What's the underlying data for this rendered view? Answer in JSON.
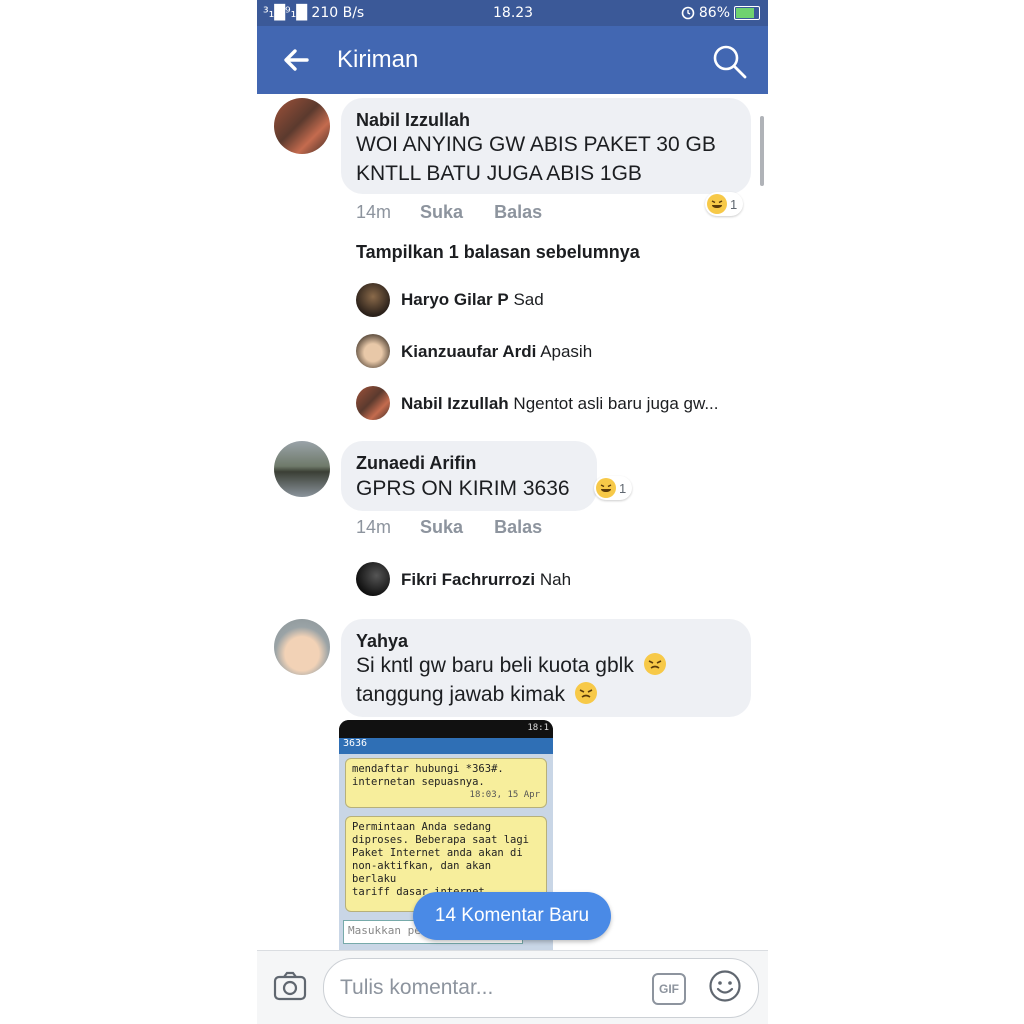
{
  "status_bar": {
    "signal": "³₁█⁹₁█ 210 B/s",
    "time": "18.23",
    "battery": "86%"
  },
  "header": {
    "title": "Kiriman"
  },
  "comments": [
    {
      "author": "Nabil Izzullah",
      "text_lines": [
        "WOI ANYING GW ABIS PAKET 30 GB",
        "KNTLL BATU JUGA ABIS 1GB"
      ],
      "time": "14m",
      "like": "Suka",
      "reply": "Balas",
      "reaction_count": "1"
    },
    {
      "author": "Zunaedi Arifin",
      "text_lines": [
        "GPRS ON KIRIM 3636"
      ],
      "time": "14m",
      "like": "Suka",
      "reply": "Balas",
      "reaction_count": "1"
    },
    {
      "author": "Yahya",
      "text_lines": [
        "Si kntl gw baru beli kuota gblk",
        "tanggung jawab kimak"
      ]
    }
  ],
  "show_previous": "Tampilkan 1 balasan sebelumnya",
  "replies": [
    {
      "author": "Haryo Gilar P",
      "text": "Sad"
    },
    {
      "author": "Kianzuaufar Ardi",
      "text": "Apasih"
    },
    {
      "author": "Nabil Izzullah",
      "text": "Ngentot asli baru juga gw..."
    },
    {
      "author": "Fikri Fachrurrozi",
      "text": "Nah"
    }
  ],
  "attachment": {
    "status_time": "18:1",
    "thread_title": "3636",
    "sms1_lines": [
      "mendaftar hubungi *363#.",
      "internetan sepuasnya."
    ],
    "sms1_time": "18:03, 15 Apr",
    "sms2_lines": [
      "Permintaan Anda sedang",
      "diproses. Beberapa saat lagi",
      "Paket Internet anda akan di",
      "non-aktifkan, dan akan berlaku",
      "tariff dasar internet."
    ],
    "input_placeholder": "Masukkan pesan di"
  },
  "new_comments_button": "14 Komentar Baru",
  "composer": {
    "placeholder": "Tulis komentar...",
    "gif_label": "GIF"
  },
  "colors": {
    "header": "#4267b2",
    "status_bar": "#3b5998",
    "bubble": "#eef0f4",
    "pill": "#4a8ae6"
  }
}
